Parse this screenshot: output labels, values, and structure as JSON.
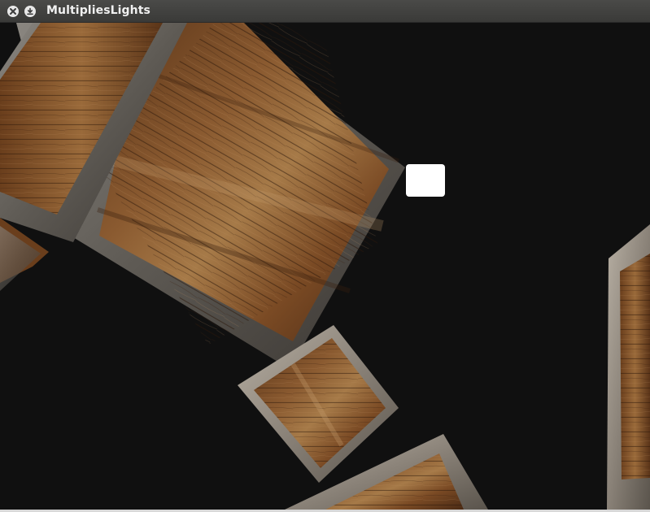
{
  "window": {
    "title": "MultipliesLights",
    "close_icon": "close-icon",
    "minimize_icon": "minimize-icon"
  },
  "scene": {
    "background_color": "#101010",
    "light_color": "#ffffff",
    "crate_wood_color": "#7a4a28",
    "crate_frame_color": "#6e6a64",
    "objects": [
      "wooden-crate",
      "wooden-crate",
      "wooden-crate",
      "wooden-crate",
      "wooden-crate",
      "light-source-cube"
    ]
  }
}
